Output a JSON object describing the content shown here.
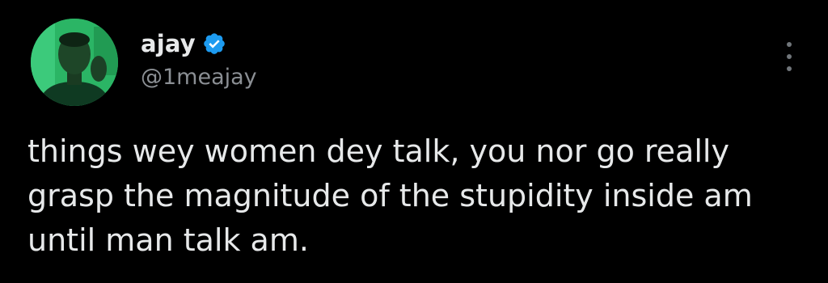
{
  "tweet": {
    "author": {
      "display_name": "ajay",
      "handle": "@1meajay",
      "verified": true
    },
    "text": "things wey women dey talk, you nor go really\ngrasp the magnitude of the stupidity inside am\nuntil man talk am."
  },
  "icons": {
    "verified": "verified-badge-icon",
    "more": "more-options-icon"
  },
  "colors": {
    "background": "#000000",
    "text": "#e7e9ea",
    "handle": "#8b8f94",
    "verified": "#1d9bf0",
    "more": "#71767b"
  }
}
